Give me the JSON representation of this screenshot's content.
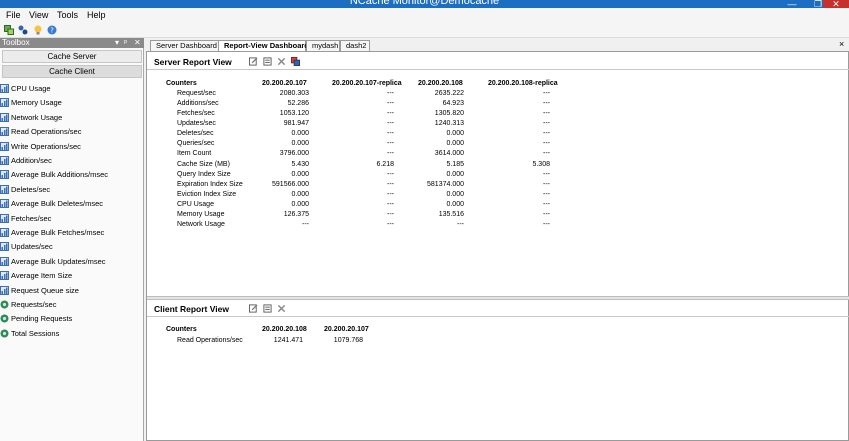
{
  "window": {
    "title": "NCache Monitor@Democache",
    "min": "—",
    "max": "❐",
    "close": "✕"
  },
  "menu": [
    "File",
    "View",
    "Tools",
    "Help"
  ],
  "toolbox": {
    "title": "Toolbox",
    "controls": [
      "▾",
      "ᵖ",
      "✕"
    ],
    "categories": [
      "Cache Server",
      "Cache Client"
    ],
    "items": [
      "CPU Usage",
      "Memory Usage",
      "Network Usage",
      "Read Operations/sec",
      "Write Operations/sec",
      "Addition/sec",
      "Average Bulk Additions/msec",
      "Deletes/sec",
      "Average Bulk Deletes/msec",
      "Fetches/sec",
      "Average Bulk Fetches/msec",
      "Updates/sec",
      "Average Bulk Updates/msec",
      "Average Item Size",
      "Request Queue size",
      "Requests/sec",
      "Pending Requests",
      "Total Sessions"
    ]
  },
  "tabs": [
    "Server Dashboard",
    "Report-View Dashboard",
    "mydash",
    "dash2"
  ],
  "tab_close": "×",
  "server_report": {
    "title": "Server Report View",
    "headers": [
      "Counters",
      "20.200.20.107",
      "20.200.20.107-replica",
      "20.200.20.108",
      "20.200.20.108-replica"
    ],
    "rows": [
      [
        "Request/sec",
        "2080.303",
        "---",
        "2635.222",
        "---"
      ],
      [
        "Additions/sec",
        "52.286",
        "---",
        "64.923",
        "---"
      ],
      [
        "Fetches/sec",
        "1053.120",
        "---",
        "1305.820",
        "---"
      ],
      [
        "Updates/sec",
        "981.947",
        "---",
        "1240.313",
        "---"
      ],
      [
        "Deletes/sec",
        "0.000",
        "---",
        "0.000",
        "---"
      ],
      [
        "Queries/sec",
        "0.000",
        "---",
        "0.000",
        "---"
      ],
      [
        "Item Count",
        "3796.000",
        "---",
        "3614.000",
        "---"
      ],
      [
        "Cache Size (MB)",
        "5.430",
        "6.218",
        "5.185",
        "5.308"
      ],
      [
        "Query Index Size",
        "0.000",
        "---",
        "0.000",
        "---"
      ],
      [
        "Expiration Index Size",
        "591566.000",
        "---",
        "581374.000",
        "---"
      ],
      [
        "Eviction Index Size",
        "0.000",
        "---",
        "0.000",
        "---"
      ],
      [
        "CPU Usage",
        "0.000",
        "---",
        "0.000",
        "---"
      ],
      [
        "Memory Usage",
        "126.375",
        "---",
        "135.516",
        "---"
      ],
      [
        "Network Usage",
        "---",
        "---",
        "---",
        "---"
      ]
    ]
  },
  "client_report": {
    "title": "Client Report View",
    "headers": [
      "Counters",
      "20.200.20.108",
      "20.200.20.107"
    ],
    "rows": [
      [
        "Read Operations/sec",
        "1241.471",
        "1079.768"
      ]
    ]
  }
}
